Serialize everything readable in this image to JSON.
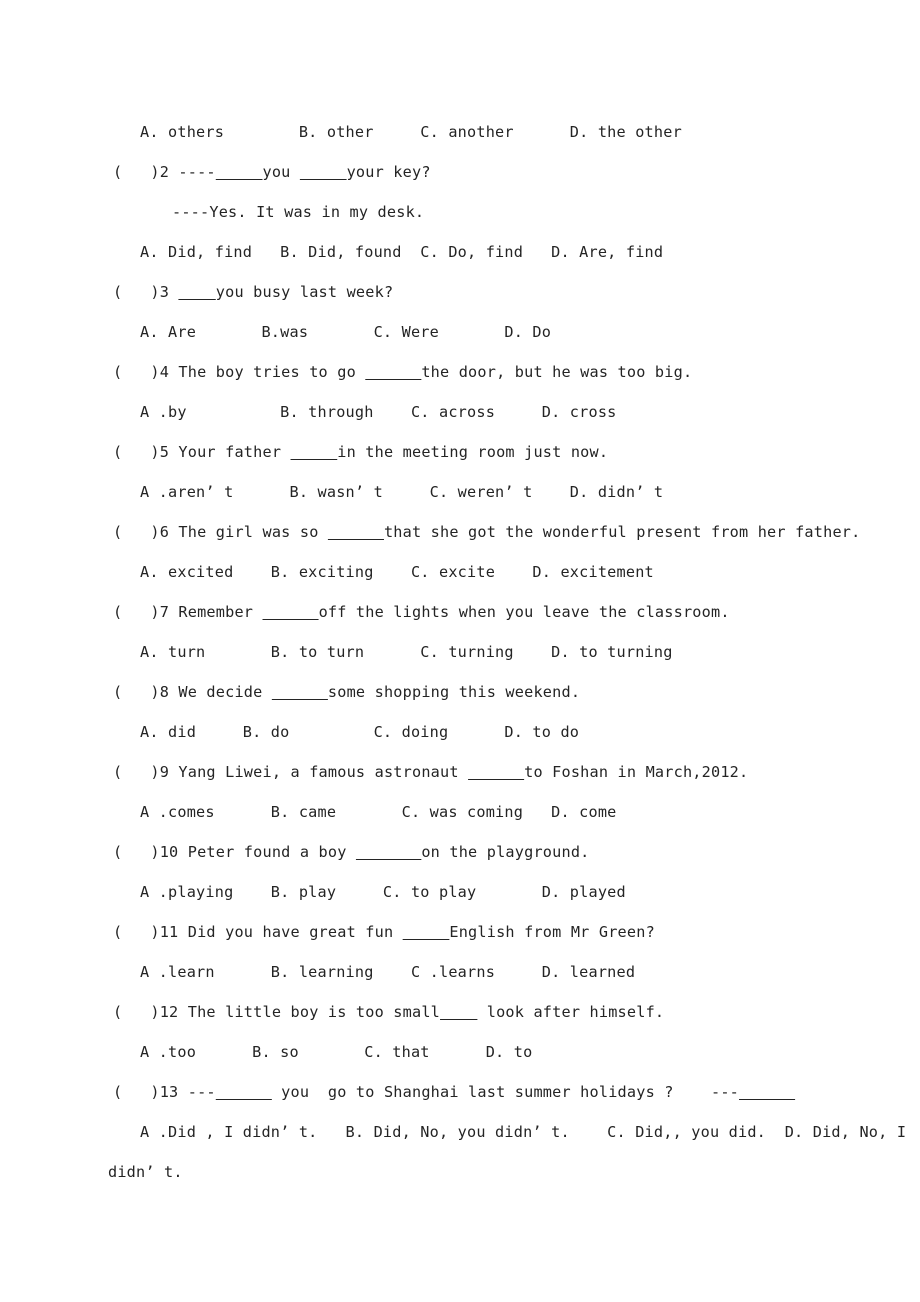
{
  "document": {
    "type": "english-grammar-multiple-choice-worksheet",
    "page_background": "#ffffff",
    "text_color": "#242424"
  },
  "lines": [
    {
      "id": "l01",
      "kind": "options",
      "indent": "ind-opt",
      "text": "A. others        B. other     C. another      D. the other"
    },
    {
      "id": "l02",
      "kind": "question",
      "indent": "ind-q",
      "text": "(   )2 ----_____you _____your key?"
    },
    {
      "id": "l03",
      "kind": "dialogue-reply",
      "indent": "ind-reply",
      "text": "----Yes. It was in my desk."
    },
    {
      "id": "l04",
      "kind": "options",
      "indent": "ind-opt",
      "text": "A. Did, find   B. Did, found  C. Do, find   D. Are, find"
    },
    {
      "id": "l05",
      "kind": "question",
      "indent": "ind-q",
      "text": "(   )3 ____you busy last week?"
    },
    {
      "id": "l06",
      "kind": "options",
      "indent": "ind-opt",
      "text": "A. Are       B.was       C. Were       D. Do"
    },
    {
      "id": "l07",
      "kind": "question",
      "indent": "ind-q",
      "text": "(   )4 The boy tries to go ______the door, but he was too big."
    },
    {
      "id": "l08",
      "kind": "options",
      "indent": "ind-opt",
      "text": "A .by          B. through    C. across     D. cross"
    },
    {
      "id": "l09",
      "kind": "question",
      "indent": "ind-q",
      "text": "(   )5 Your father _____in the meeting room just now."
    },
    {
      "id": "l10",
      "kind": "options",
      "indent": "ind-opt",
      "text": "A .aren’ t      B. wasn’ t     C. weren’ t    D. didn’ t"
    },
    {
      "id": "l11",
      "kind": "question",
      "indent": "ind-q",
      "text": "(   )6 The girl was so ______that she got the wonderful present from her father."
    },
    {
      "id": "l12",
      "kind": "options",
      "indent": "ind-opt",
      "text": "A. excited    B. exciting    C. excite    D. excitement"
    },
    {
      "id": "l13",
      "kind": "question",
      "indent": "ind-q",
      "text": "(   )7 Remember ______off the lights when you leave the classroom."
    },
    {
      "id": "l14",
      "kind": "options",
      "indent": "ind-opt",
      "text": "A. turn       B. to turn      C. turning    D. to turning"
    },
    {
      "id": "l15",
      "kind": "question",
      "indent": "ind-q",
      "text": "(   )8 We decide ______some shopping this weekend."
    },
    {
      "id": "l16",
      "kind": "options",
      "indent": "ind-opt",
      "text": "A. did     B. do         C. doing      D. to do"
    },
    {
      "id": "l17",
      "kind": "question",
      "indent": "ind-q",
      "text": "(   )9 Yang Liwei, a famous astronaut ______to Foshan in March,2012."
    },
    {
      "id": "l18",
      "kind": "options",
      "indent": "ind-opt",
      "text": "A .comes      B. came       C. was coming   D. come"
    },
    {
      "id": "l19",
      "kind": "question",
      "indent": "ind-q",
      "text": "(   )10 Peter found a boy _______on the playground."
    },
    {
      "id": "l20",
      "kind": "options",
      "indent": "ind-opt",
      "text": "A .playing    B. play     C. to play       D. played"
    },
    {
      "id": "l21",
      "kind": "question",
      "indent": "ind-q",
      "text": "(   )11 Did you have great fun _____English from Mr Green?"
    },
    {
      "id": "l22",
      "kind": "options",
      "indent": "ind-opt",
      "text": "A .learn      B. learning    C .learns     D. learned"
    },
    {
      "id": "l23",
      "kind": "question",
      "indent": "ind-q",
      "text": "(   )12 The little boy is too small____ look after himself."
    },
    {
      "id": "l24",
      "kind": "options",
      "indent": "ind-opt",
      "text": "A .too      B. so       C. that      D. to"
    },
    {
      "id": "l25",
      "kind": "question",
      "indent": "ind-q",
      "text": "(   )13 ---______ you  go to Shanghai last summer holidays ?    ---______"
    },
    {
      "id": "l26",
      "kind": "options",
      "indent": "ind-opt",
      "text": "A .Did , I didn’ t.   B. Did, No, you didn’ t.    C. Did,, you did.  D. Did, No, I"
    },
    {
      "id": "l27",
      "kind": "options-continuation",
      "indent": "ind-none",
      "text": "didn’ t."
    }
  ]
}
